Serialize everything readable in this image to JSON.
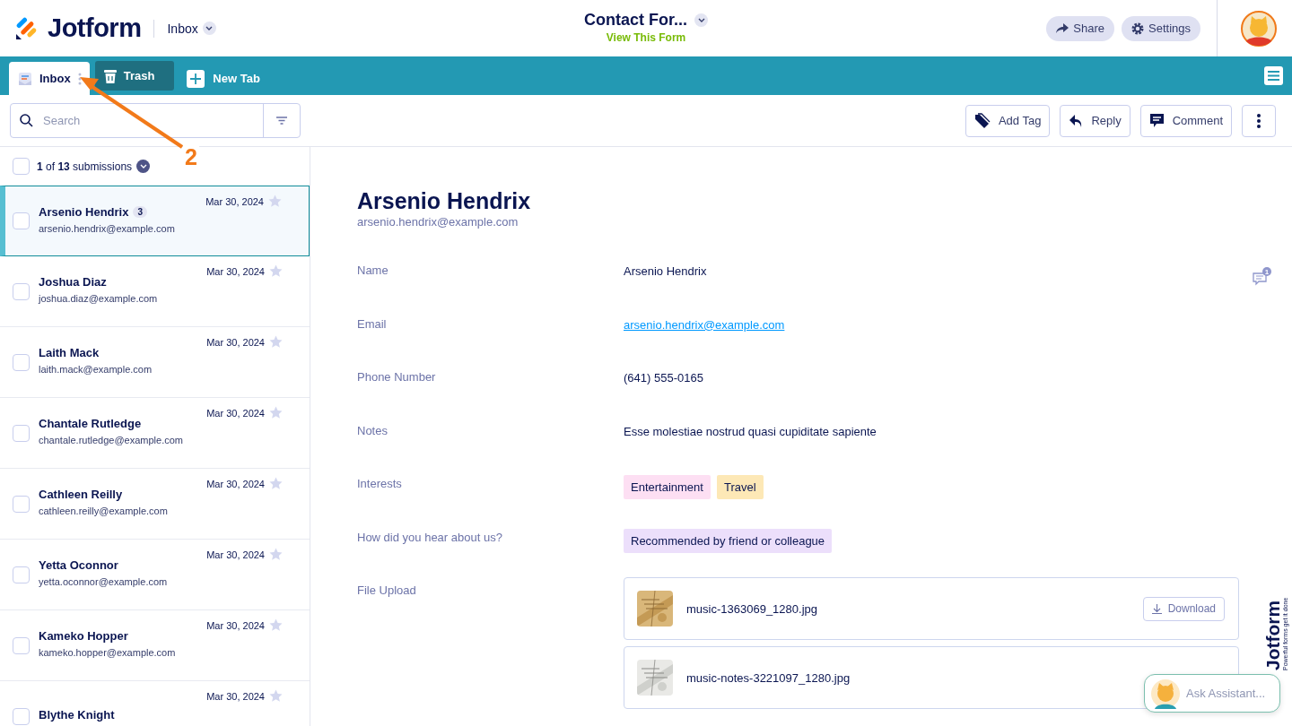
{
  "header": {
    "logo": "Jotform",
    "section": "Inbox",
    "form_title": "Contact For...",
    "form_link": "View This Form",
    "buttons": [
      {
        "kind": "share",
        "label": "Share"
      },
      {
        "kind": "settings",
        "label": "Settings"
      }
    ]
  },
  "tabs": [
    {
      "label": "Inbox",
      "kind": "inbox",
      "selected": true
    },
    {
      "label": "Trash",
      "kind": "trash",
      "selected": false
    }
  ],
  "new_tab": "New Tab",
  "search": {
    "placeholder": "Search"
  },
  "actions": [
    {
      "kind": "tag",
      "label": "Add Tag"
    },
    {
      "kind": "reply",
      "label": "Reply"
    },
    {
      "kind": "comment",
      "label": "Comment"
    },
    {
      "kind": "more"
    }
  ],
  "list_header": {
    "checked": false,
    "text": "**1** of **13** submissions"
  },
  "submissions": [
    {
      "name": "Arsenio Hendrix",
      "badge": "3",
      "email": "arsenio.hendrix@example.com",
      "date": "Mar 30, 2024",
      "selected": true,
      "checked": false,
      "starred": false
    },
    {
      "name": "Joshua Diaz",
      "email": "joshua.diaz@example.com",
      "date": "Mar 30, 2024",
      "selected": false,
      "checked": false,
      "starred": false
    },
    {
      "name": "Laith Mack",
      "email": "laith.mack@example.com",
      "date": "Mar 30, 2024",
      "selected": false,
      "checked": false,
      "starred": false
    },
    {
      "name": "Chantale Rutledge",
      "email": "chantale.rutledge@example.com",
      "date": "Mar 30, 2024",
      "selected": false,
      "checked": false,
      "starred": false
    },
    {
      "name": "Cathleen Reilly",
      "email": "cathleen.reilly@example.com",
      "date": "Mar 30, 2024",
      "selected": false,
      "checked": false,
      "starred": false
    },
    {
      "name": "Yetta Oconnor",
      "email": "yetta.oconnor@example.com",
      "date": "Mar 30, 2024",
      "selected": false,
      "checked": false,
      "starred": false
    },
    {
      "name": "Kameko Hopper",
      "email": "kameko.hopper@example.com",
      "date": "Mar 30, 2024",
      "selected": false,
      "checked": false,
      "starred": false
    },
    {
      "name": "Blythe Knight",
      "date": "Mar 30, 2024",
      "selected": false,
      "checked": false,
      "starred": false
    }
  ],
  "detail": {
    "name": "Arsenio Hendrix",
    "email": "arsenio.hendrix@example.com",
    "comment_count": "1",
    "fields": [
      {
        "label": "Name",
        "kind": "text",
        "value": "Arsenio Hendrix"
      },
      {
        "label": "Email",
        "kind": "link",
        "value": "arsenio.hendrix@example.com"
      },
      {
        "label": "Phone Number",
        "kind": "text",
        "value": "(641) 555-0165"
      },
      {
        "label": "Notes",
        "kind": "text",
        "value": "Esse molestiae nostrud quasi cupiditate sapiente"
      },
      {
        "label": "Interests",
        "kind": "tags",
        "tags": [
          {
            "text": "Entertainment",
            "color": "#fddff3"
          },
          {
            "text": "Travel",
            "color": "#fde8b6"
          }
        ]
      },
      {
        "label": "How did you hear about us?",
        "kind": "tags",
        "tags": [
          {
            "text": "Recommended by friend or colleague",
            "color": "#ecdffb"
          }
        ]
      },
      {
        "label": "File Upload",
        "kind": "files",
        "files": [
          {
            "name": "music-1363069_1280.jpg",
            "download": "Download",
            "kind": "picture"
          },
          {
            "name": "music-notes-3221097_1280.jpg",
            "kind": "picture"
          }
        ]
      }
    ]
  },
  "assistant": {
    "label": "Ask Assistant..."
  },
  "badge": {
    "brand": "Jotform",
    "tagline": "Powerful forms get it done"
  },
  "annotation": {
    "number": "2"
  }
}
